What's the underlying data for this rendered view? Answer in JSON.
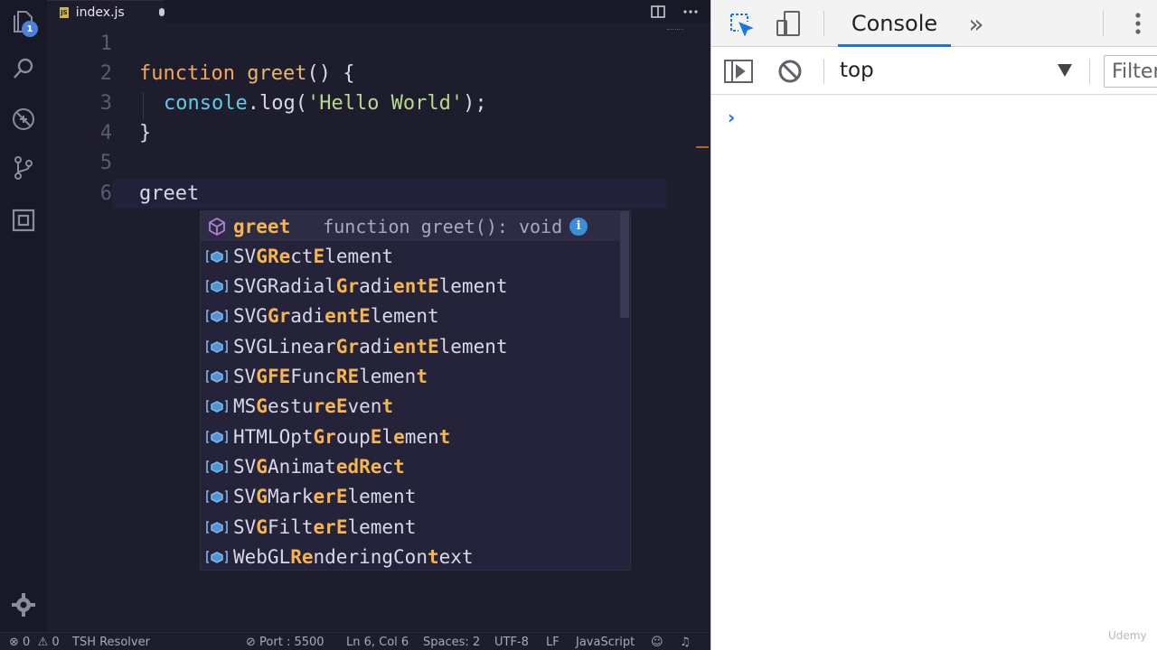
{
  "editor": {
    "activity_badge": "1",
    "tab": {
      "badge": "JS",
      "filename": "index.js"
    },
    "lines": [
      "1",
      "2",
      "3",
      "4",
      "5",
      "6"
    ],
    "code": {
      "l2_keyword": "function",
      "l2_name": "greet",
      "l2_punct": "() {",
      "l3_obj": "console",
      "l3_dot": ".",
      "l3_method": "log",
      "l3_open": "(",
      "l3_string": "'Hello World'",
      "l3_close": ");",
      "l4": "}",
      "l6": "greet"
    }
  },
  "suggest": {
    "selected": {
      "label": "greet",
      "detail": "function greet(): void",
      "info": "i"
    },
    "items": [
      [
        [
          "SV",
          0
        ],
        [
          "GRe",
          1
        ],
        [
          "ct",
          0
        ],
        [
          "E",
          1
        ],
        [
          "lement",
          0
        ]
      ],
      [
        [
          "SVGRadial",
          0
        ],
        [
          "Gr",
          1
        ],
        [
          "adi",
          0
        ],
        [
          "e",
          1
        ],
        [
          "nt",
          1
        ],
        [
          "E",
          1
        ],
        [
          "lement",
          0
        ]
      ],
      [
        [
          "SVG",
          0
        ],
        [
          "Gr",
          1
        ],
        [
          "adi",
          0
        ],
        [
          "e",
          1
        ],
        [
          "nt",
          1
        ],
        [
          "E",
          1
        ],
        [
          "lement",
          0
        ]
      ],
      [
        [
          "SVGLinear",
          0
        ],
        [
          "Gr",
          1
        ],
        [
          "adi",
          0
        ],
        [
          "e",
          1
        ],
        [
          "nt",
          1
        ],
        [
          "E",
          1
        ],
        [
          "lement",
          0
        ]
      ],
      [
        [
          "SV",
          0
        ],
        [
          "GFE",
          1
        ],
        [
          "Func",
          0
        ],
        [
          "RE",
          1
        ],
        [
          "lemen",
          0
        ],
        [
          "t",
          1
        ]
      ],
      [
        [
          "MS",
          0
        ],
        [
          "G",
          1
        ],
        [
          "estu",
          0
        ],
        [
          "re",
          1
        ],
        [
          "E",
          1
        ],
        [
          "ven",
          0
        ],
        [
          "t",
          1
        ]
      ],
      [
        [
          "HTMLOpt",
          0
        ],
        [
          "Gr",
          1
        ],
        [
          "oup",
          0
        ],
        [
          "E",
          1
        ],
        [
          "l",
          0
        ],
        [
          "e",
          1
        ],
        [
          "men",
          0
        ],
        [
          "t",
          1
        ]
      ],
      [
        [
          "SV",
          0
        ],
        [
          "G",
          1
        ],
        [
          "Animat",
          0
        ],
        [
          "ed",
          1
        ],
        [
          "Re",
          1
        ],
        [
          "c",
          0
        ],
        [
          "t",
          1
        ]
      ],
      [
        [
          "SV",
          0
        ],
        [
          "G",
          1
        ],
        [
          "Mark",
          0
        ],
        [
          "er",
          1
        ],
        [
          "E",
          1
        ],
        [
          "lement",
          0
        ]
      ],
      [
        [
          "SV",
          0
        ],
        [
          "G",
          1
        ],
        [
          "Filt",
          0
        ],
        [
          "er",
          1
        ],
        [
          "E",
          1
        ],
        [
          "lement",
          0
        ]
      ],
      [
        [
          "WebGL",
          0
        ],
        [
          "Re",
          1
        ],
        [
          "nde",
          0
        ],
        [
          "r",
          0
        ],
        [
          "ingCon",
          0
        ],
        [
          "t",
          1
        ],
        [
          "ext",
          0
        ]
      ]
    ]
  },
  "status": {
    "errors": "0",
    "warnings": "0",
    "resolver": "TSH Resolver",
    "port": "Port : 5500",
    "position": "Ln 6, Col 6",
    "spaces": "Spaces: 2",
    "encoding": "UTF-8",
    "eol": "LF",
    "language": "JavaScript"
  },
  "devtools": {
    "tab_console": "Console",
    "more_tabs": "»",
    "context": "top",
    "filter_placeholder": "Filter",
    "prompt": "›"
  },
  "watermark": "Udemy",
  "colors": {
    "accent": "#1a73e8",
    "highlight": "#f5b54f",
    "keyword": "#f5a65b",
    "string": "#b8d98a"
  }
}
